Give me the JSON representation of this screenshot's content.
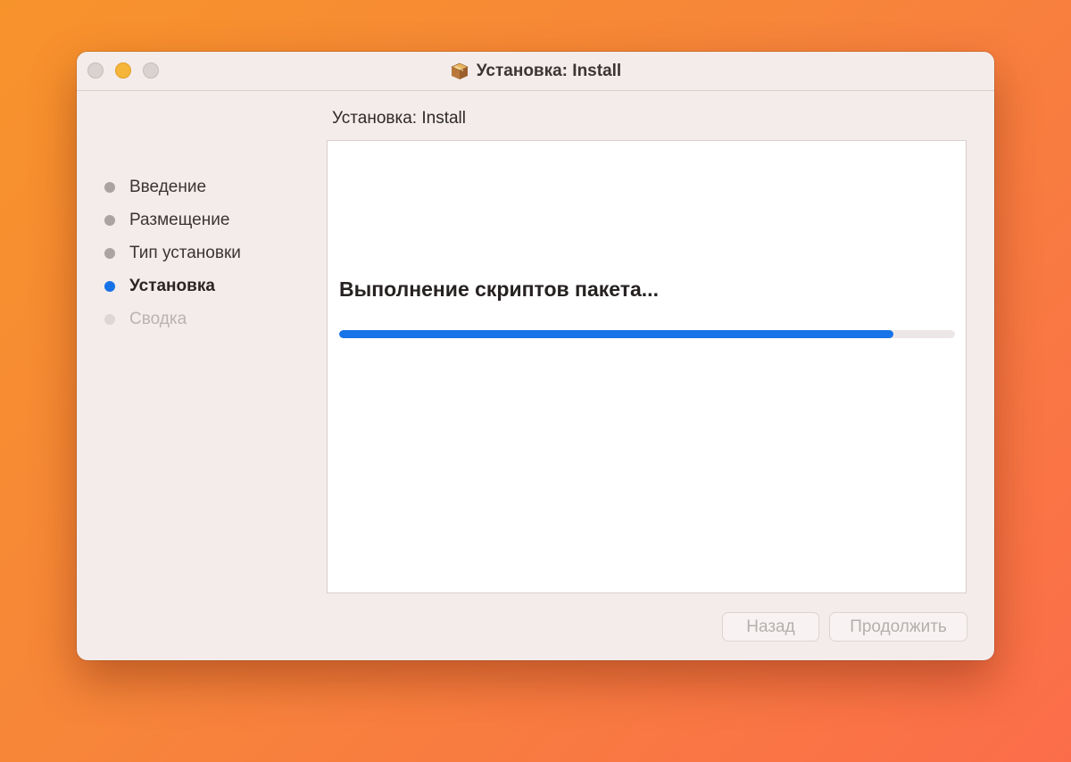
{
  "window": {
    "title": "Установка: Install",
    "title_icon": "package-icon"
  },
  "sidebar": {
    "steps": [
      {
        "label": "Введение",
        "state": "done"
      },
      {
        "label": "Размещение",
        "state": "done"
      },
      {
        "label": "Тип установки",
        "state": "done"
      },
      {
        "label": "Установка",
        "state": "current"
      },
      {
        "label": "Сводка",
        "state": "pending"
      }
    ]
  },
  "main": {
    "heading": "Установка: Install",
    "status": "Выполнение скриптов пакета...",
    "progress_fraction": 0.9
  },
  "buttons": {
    "back_label": "Назад",
    "continue_label": "Продолжить"
  },
  "colors": {
    "accent": "#1672e6",
    "window_bg": "#f4ecea",
    "minimize_button": "#f5b53a"
  }
}
